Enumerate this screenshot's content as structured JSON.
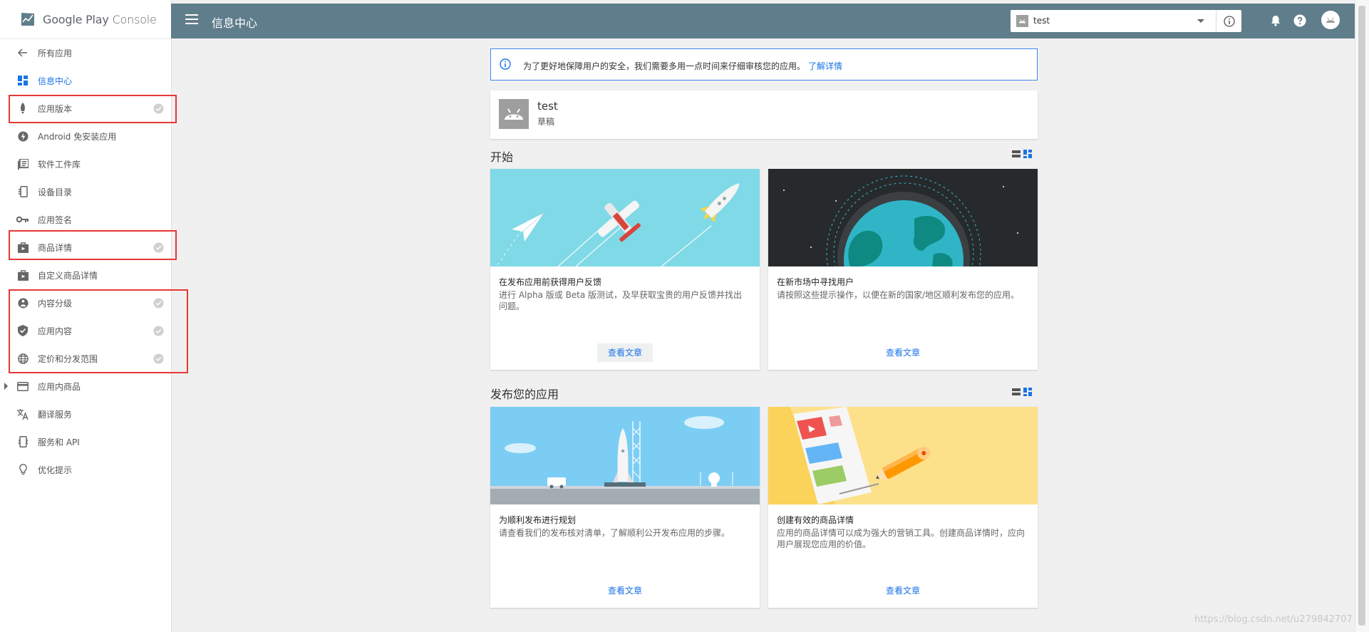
{
  "logo": {
    "text": "Google Play",
    "suffix": "Console"
  },
  "header": {
    "title": "信息中心",
    "app_select_value": "test"
  },
  "sidebar": {
    "items": [
      {
        "label": "所有应用"
      },
      {
        "label": "信息中心"
      },
      {
        "label": "应用版本"
      },
      {
        "label": "Android 免安装应用"
      },
      {
        "label": "软件工件库"
      },
      {
        "label": "设备目录"
      },
      {
        "label": "应用签名"
      },
      {
        "label": "商品详情"
      },
      {
        "label": "自定义商品详情"
      },
      {
        "label": "内容分级"
      },
      {
        "label": "应用内容"
      },
      {
        "label": "定价和分发范围"
      },
      {
        "label": "应用内商品"
      },
      {
        "label": "翻译服务"
      },
      {
        "label": "服务和 API"
      },
      {
        "label": "优化提示"
      }
    ]
  },
  "notice": {
    "text": "为了更好地保障用户的安全，我们需要多用一点时间来仔细审核您的应用。",
    "link": "了解详情"
  },
  "app": {
    "name": "test",
    "status": "草稿"
  },
  "sections": [
    {
      "title": "开始",
      "cards": [
        {
          "title": "在发布应用前获得用户反馈",
          "desc": "进行 Alpha 版或 Beta 版测试，及早获取宝贵的用户反馈并找出问题。",
          "button": "查看文章"
        },
        {
          "title": "在新市场中寻找用户",
          "desc": "请按照这些提示操作，以便在新的国家/地区顺利发布您的应用。",
          "button": "查看文章"
        }
      ]
    },
    {
      "title": "发布您的应用",
      "cards": [
        {
          "title": "为顺利发布进行规划",
          "desc": "请查看我们的发布核对清单，了解顺利公开发布应用的步骤。",
          "button": "查看文章"
        },
        {
          "title": "创建有效的商品详情",
          "desc": "应用的商品详情可以成为强大的营销工具。创建商品详情时，应向用户展现您应用的价值。",
          "button": "查看文章"
        }
      ]
    }
  ],
  "watermark": "https://blog.csdn.net/u279842707",
  "colors": {
    "topbar": "#607d8b",
    "accent": "#1a73e8",
    "highlight": "#e53935"
  }
}
